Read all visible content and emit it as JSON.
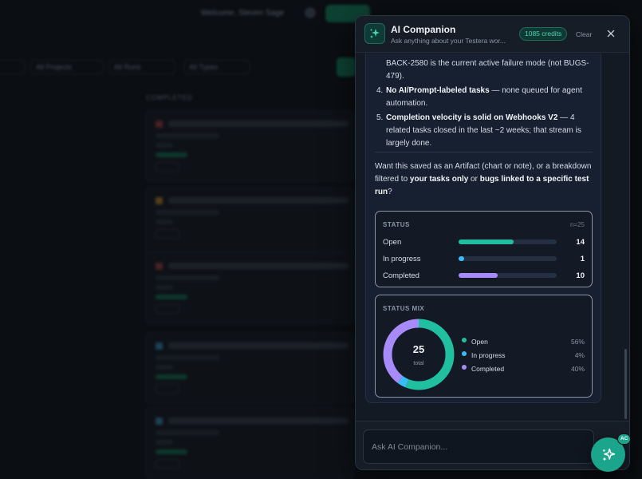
{
  "background": {
    "welcome": "Welcome, Steven Sage",
    "filters": [
      "All Projects",
      "All Runs",
      "All Types"
    ],
    "column_heading": "COMPLETED"
  },
  "panel": {
    "title": "AI Companion",
    "subtitle": "Ask anything about your Testera wor...",
    "credits": "1085 credits",
    "clear_label": "Clear",
    "message": {
      "partial_item": "BACK-2580 is the current active failure mode (not BUGS-479).",
      "items": [
        {
          "num": "4.",
          "bold": "No AI/Prompt-labeled tasks",
          "rest": " — none queued for agent automation."
        },
        {
          "num": "5.",
          "bold": "Completion velocity is solid on Webhooks V2",
          "rest": " — 4 related tasks closed in the last ~2 weeks; that stream is largely done."
        }
      ],
      "intro": {
        "p1": "Want this saved as an Artifact (chart or note), or a breakdown filtered to ",
        "b1": "your tasks only",
        "p2": " or ",
        "b2": "bugs linked to a specific test run",
        "p3": "?"
      }
    },
    "status_card": {
      "label": "STATUS",
      "n_label": "n=25",
      "rows": [
        {
          "label": "Open",
          "value": "14",
          "fraction": 0.56,
          "color": "#1fbfa0"
        },
        {
          "label": "In progress",
          "value": "1",
          "fraction": 0.04,
          "color": "#38bdf8"
        },
        {
          "label": "Completed",
          "value": "10",
          "fraction": 0.4,
          "color": "#a78bfa"
        }
      ]
    },
    "mix_card": {
      "label": "STATUS MIX",
      "total": "25",
      "total_label": "total",
      "legend": [
        {
          "label": "Open",
          "pct": "56%",
          "color": "#1fbfa0"
        },
        {
          "label": "In progress",
          "pct": "4%",
          "color": "#38bdf8"
        },
        {
          "label": "Completed",
          "pct": "40%",
          "color": "#a78bfa"
        }
      ]
    },
    "input_placeholder": "Ask AI Companion...",
    "fab_badge": "AC"
  },
  "chart_data": {
    "type": "pie",
    "title": "STATUS MIX",
    "categories": [
      "Open",
      "In progress",
      "Completed"
    ],
    "values": [
      14,
      1,
      10
    ],
    "percentages": [
      56,
      4,
      40
    ],
    "total": 25
  },
  "icons": {
    "logo": "sparkles-icon",
    "close": "close-icon",
    "fab": "sparkles-icon"
  }
}
